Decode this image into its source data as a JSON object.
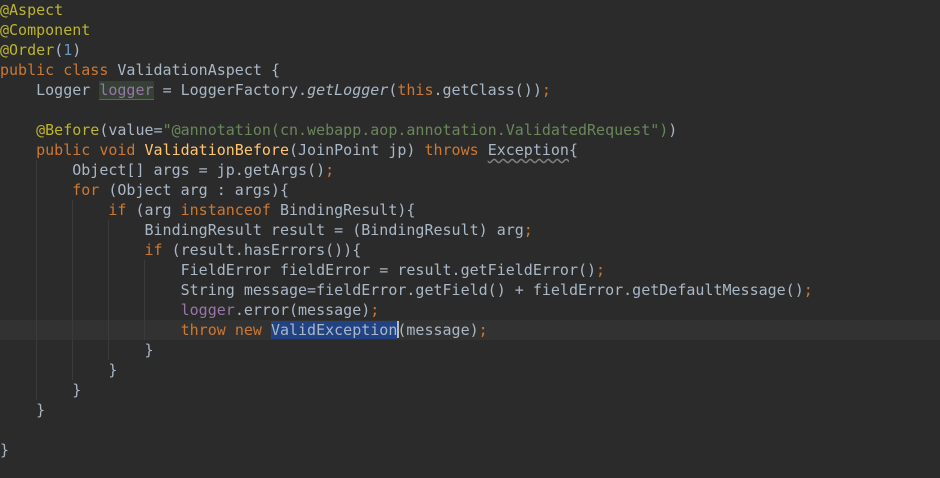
{
  "editor": {
    "line1": {
      "annotation": "@Aspect"
    },
    "line2": {
      "annotation": "@Component"
    },
    "line3": {
      "annotation": "@Order",
      "open": "(",
      "number": "1",
      "close": ")"
    },
    "line4": {
      "kw_public": "public",
      "kw_class": "class",
      "class_name": "ValidationAspect",
      "brace": "{"
    },
    "line5": {
      "type": "Logger",
      "field": "logger",
      "assign": "=",
      "factory": "LoggerFactory.",
      "method": "getLogger",
      "open": "(",
      "kw_this": "this",
      "rest": ".getClass())",
      "semi": ";"
    },
    "line6": {},
    "line7": {
      "annotation": "@Before",
      "open": "(value=",
      "string": "\"@annotation(cn.webapp.aop.annotation.ValidatedRequest\")",
      "close": ")"
    },
    "line8": {
      "kw_public": "public",
      "kw_void": "void",
      "method": "ValidationBefore",
      "params": "(JoinPoint jp)",
      "kw_throws": "throws",
      "exception": "Exception",
      "brace": "{"
    },
    "line9": {
      "code": "Object[] args = jp.getArgs()",
      "semi": ";"
    },
    "line10": {
      "kw_for": "for",
      "code": "(Object arg : args){"
    },
    "line11": {
      "kw_if": "if",
      "code_a": "(arg",
      "kw_instanceof": "instanceof",
      "code_b": "BindingResult){"
    },
    "line12": {
      "code": "BindingResult result = (BindingResult) arg",
      "semi": ";"
    },
    "line13": {
      "kw_if": "if",
      "code": "(result.hasErrors()){"
    },
    "line14": {
      "code": "FieldError fieldError = result.getFieldError()",
      "semi": ";"
    },
    "line15": {
      "code": "String message=fieldError.getField() + fieldError.getDefaultMessage()",
      "semi": ";"
    },
    "line16": {
      "field": "logger",
      "code": ".error(message)",
      "semi": ";"
    },
    "line17": {
      "kw_throw": "throw",
      "kw_new": "new",
      "selected": "ValidException",
      "code": "(message)",
      "semi": ";"
    },
    "line18": {
      "brace": "}"
    },
    "line19": {
      "brace": "}"
    },
    "line20": {
      "brace": "}"
    },
    "line21": {
      "brace": "}"
    },
    "line22": {},
    "line23": {
      "brace": "}"
    }
  }
}
